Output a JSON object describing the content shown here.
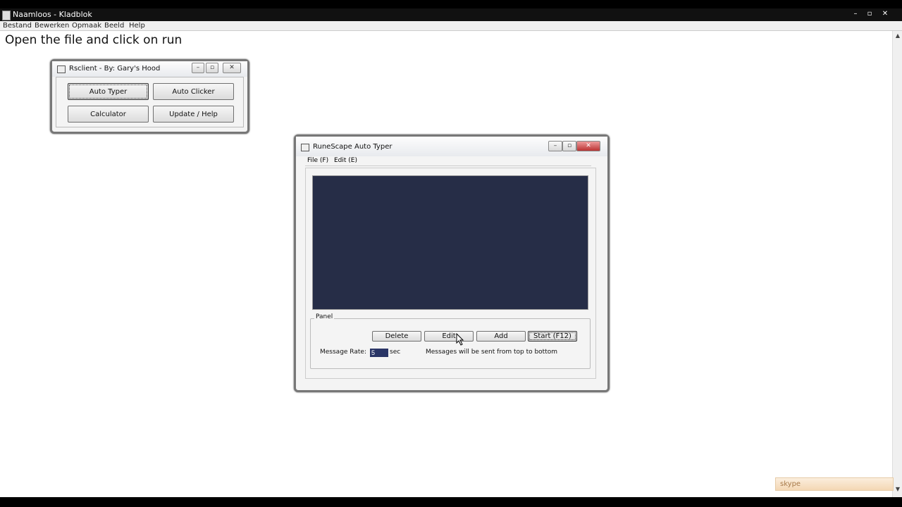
{
  "notepad": {
    "title": "Naamloos - Kladblok",
    "menu": [
      "Bestand",
      "Bewerken",
      "Opmaak",
      "Beeld",
      "Help"
    ],
    "body_text": "Open the file and click on run",
    "controls": {
      "minimize": "–",
      "maximize": "▫",
      "close": "✕"
    }
  },
  "rsclient": {
    "title": "Rsclient - By: Gary's Hood",
    "buttons": {
      "auto_typer": "Auto Typer",
      "auto_clicker": "Auto Clicker",
      "calculator": "Calculator",
      "update_help": "Update / Help"
    },
    "controls": {
      "minimize": "–",
      "maximize": "▫",
      "close": "✕"
    }
  },
  "autotyper": {
    "title": "RuneScape Auto Typer",
    "menu": {
      "file": "File (F)",
      "edit": "Edit (E)"
    },
    "panel_label": "Panel",
    "buttons": {
      "delete": "Delete",
      "edit": "Edit",
      "add": "Add",
      "start": "Start (F12)"
    },
    "message_rate_label": "Message Rate:",
    "message_rate_value": "5",
    "message_rate_unit": "sec",
    "info_text": "Messages will be sent from top to bottom",
    "controls": {
      "minimize": "–",
      "maximize": "▫",
      "close": "✕"
    }
  },
  "tray": {
    "skype_text": "skype"
  },
  "colors": {
    "list_bg": "#262d47",
    "rate_input_bg": "#2a3566"
  }
}
